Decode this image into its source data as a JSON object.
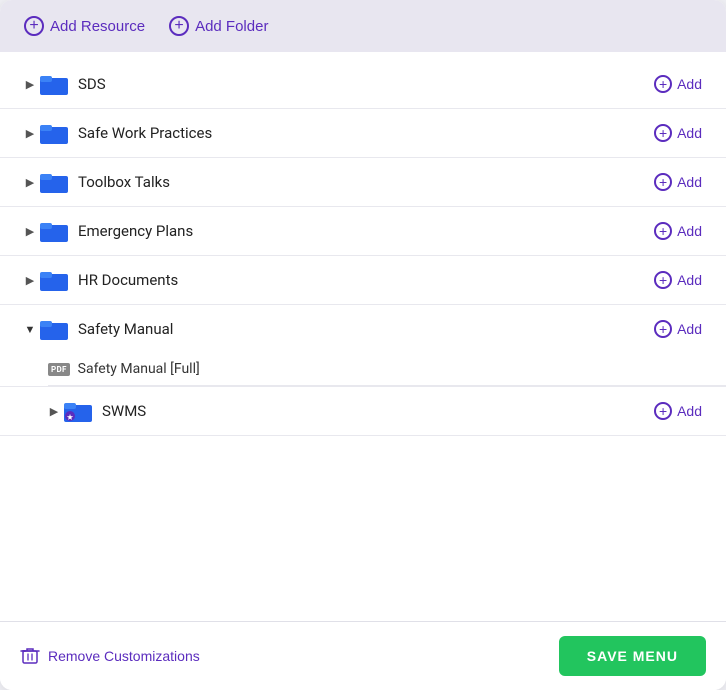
{
  "toolbar": {
    "add_resource_label": "Add Resource",
    "add_folder_label": "Add Folder"
  },
  "tree": {
    "items": [
      {
        "id": "sds",
        "label": "SDS",
        "expanded": false,
        "children": []
      },
      {
        "id": "safe-work",
        "label": "Safe Work Practices",
        "expanded": false,
        "children": []
      },
      {
        "id": "toolbox",
        "label": "Toolbox Talks",
        "expanded": false,
        "children": []
      },
      {
        "id": "emergency",
        "label": "Emergency Plans",
        "expanded": false,
        "children": []
      },
      {
        "id": "hr",
        "label": "HR Documents",
        "expanded": false,
        "children": []
      },
      {
        "id": "safety-manual",
        "label": "Safety Manual",
        "expanded": true,
        "children": [
          {
            "id": "safety-manual-full",
            "label": "Safety Manual [Full]",
            "type": "pdf"
          }
        ]
      },
      {
        "id": "swms",
        "label": "SWMS",
        "expanded": false,
        "children": [],
        "indented": true
      }
    ],
    "add_label": "Add"
  },
  "footer": {
    "remove_label": "Remove Customizations",
    "save_label": "SAVE MENU"
  },
  "colors": {
    "purple": "#5b2cbe",
    "green": "#22c55e",
    "folder_blue": "#2563eb"
  }
}
